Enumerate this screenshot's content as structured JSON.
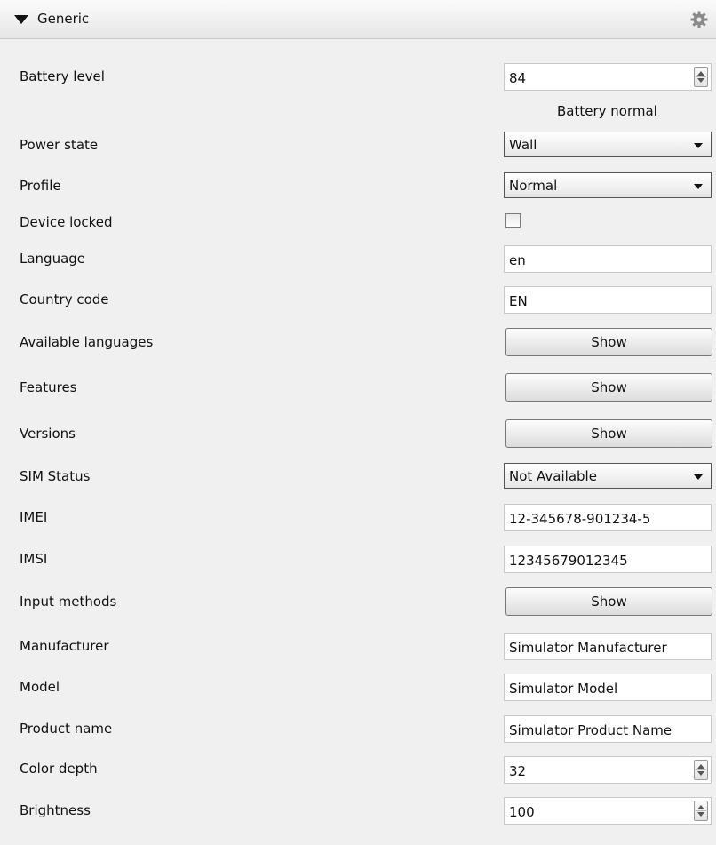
{
  "section": {
    "title": "Generic",
    "settings_icon": "gear-icon",
    "collapse_icon": "triangle-down-icon"
  },
  "battery": {
    "label": "Battery level",
    "value": "84",
    "status": "Battery normal"
  },
  "power_state": {
    "label": "Power state",
    "selected": "Wall"
  },
  "profile": {
    "label": "Profile",
    "selected": "Normal"
  },
  "device_locked": {
    "label": "Device locked",
    "checked": false
  },
  "language": {
    "label": "Language",
    "value": "en"
  },
  "country_code": {
    "label": "Country code",
    "value": "EN"
  },
  "available_languages": {
    "label": "Available languages",
    "button": "Show"
  },
  "features": {
    "label": "Features",
    "button": "Show"
  },
  "versions": {
    "label": "Versions",
    "button": "Show"
  },
  "sim_status": {
    "label": "SIM Status",
    "selected": "Not Available"
  },
  "imei": {
    "label": "IMEI",
    "value": "12-345678-901234-5"
  },
  "imsi": {
    "label": "IMSI",
    "value": "12345679012345"
  },
  "input_methods": {
    "label": "Input methods",
    "button": "Show"
  },
  "manufacturer": {
    "label": "Manufacturer",
    "value": "Simulator Manufacturer"
  },
  "model": {
    "label": "Model",
    "value": "Simulator Model"
  },
  "product_name": {
    "label": "Product name",
    "value": "Simulator Product Name"
  },
  "color_depth": {
    "label": "Color depth",
    "value": "32"
  },
  "brightness": {
    "label": "Brightness",
    "value": "100"
  }
}
